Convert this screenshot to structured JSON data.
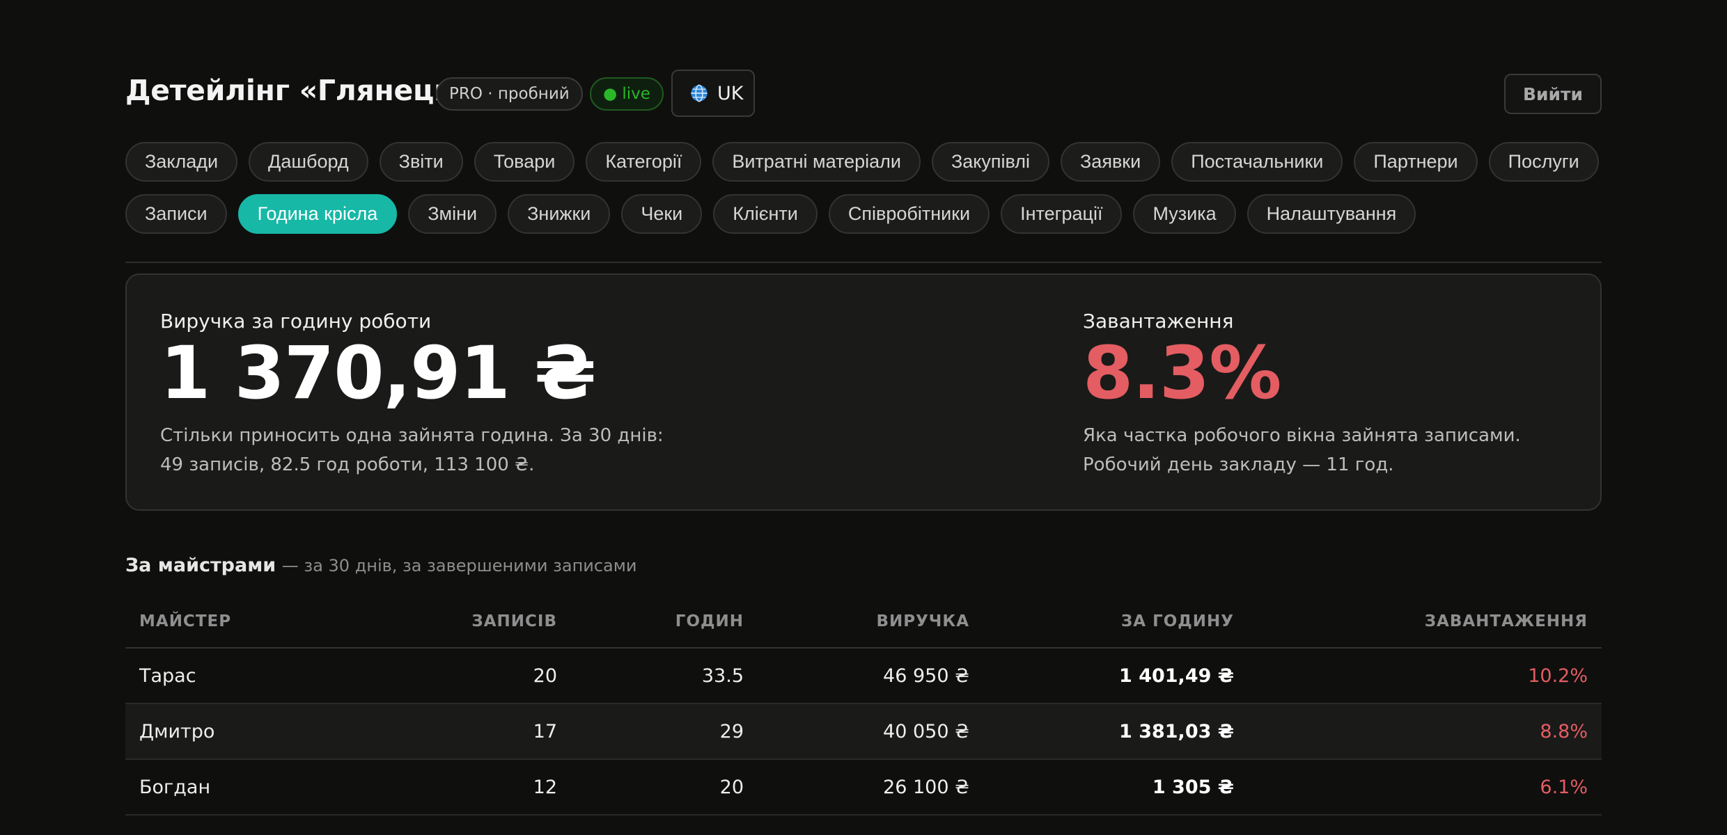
{
  "header": {
    "title": "Детейлінг «Глянець»",
    "plan_badge": "PRO · пробний",
    "status_badge": "● live",
    "language": "UK",
    "logout": "Вийти"
  },
  "nav": {
    "row1": [
      "Заклади",
      "Дашборд",
      "Звіти",
      "Товари",
      "Категорії",
      "Витратні матеріали",
      "Закупівлі",
      "Заявки",
      "Постачальники",
      "Партнери",
      "Послуги"
    ],
    "row2": [
      "Записи",
      "Година крісла",
      "Зміни",
      "Знижки",
      "Чеки",
      "Клієнти",
      "Співробітники",
      "Інтеграції",
      "Музика",
      "Налаштування"
    ],
    "active": "Година крісла"
  },
  "summary": {
    "revenue": {
      "label": "Виручка за годину роботи",
      "value": "1 370,91 ₴",
      "desc_line1": "Стільки приносить одна зайнята година. За 30 днів:",
      "desc_line2": "49 записів, 82.5 год роботи, 113 100 ₴."
    },
    "load": {
      "label": "Завантаження",
      "value": "8.3%",
      "desc_line1": "Яка частка робочого вікна зайнята записами.",
      "desc_line2": "Робочий день закладу — 11 год."
    }
  },
  "masters": {
    "title": "За майстрами",
    "subtitle": "— за 30 днів, за завершеними записами",
    "columns": [
      "МАЙСТЕР",
      "ЗАПИСІВ",
      "ГОДИН",
      "ВИРУЧКА",
      "ЗА ГОДИНУ",
      "ЗАВАНТАЖЕННЯ"
    ],
    "rows": [
      {
        "name": "Тарас",
        "records": "20",
        "hours": "33.5",
        "revenue": "46 950 ₴",
        "per_hour": "1 401,49 ₴",
        "load": "10.2%"
      },
      {
        "name": "Дмитро",
        "records": "17",
        "hours": "29",
        "revenue": "40 050 ₴",
        "per_hour": "1 381,03 ₴",
        "load": "8.8%"
      },
      {
        "name": "Богдан",
        "records": "12",
        "hours": "20",
        "revenue": "26 100 ₴",
        "per_hour": "1 305 ₴",
        "load": "6.1%"
      }
    ]
  },
  "colors": {
    "accent": "#17b8a6",
    "load_red": "#e35d62",
    "live_green": "#29b729"
  }
}
